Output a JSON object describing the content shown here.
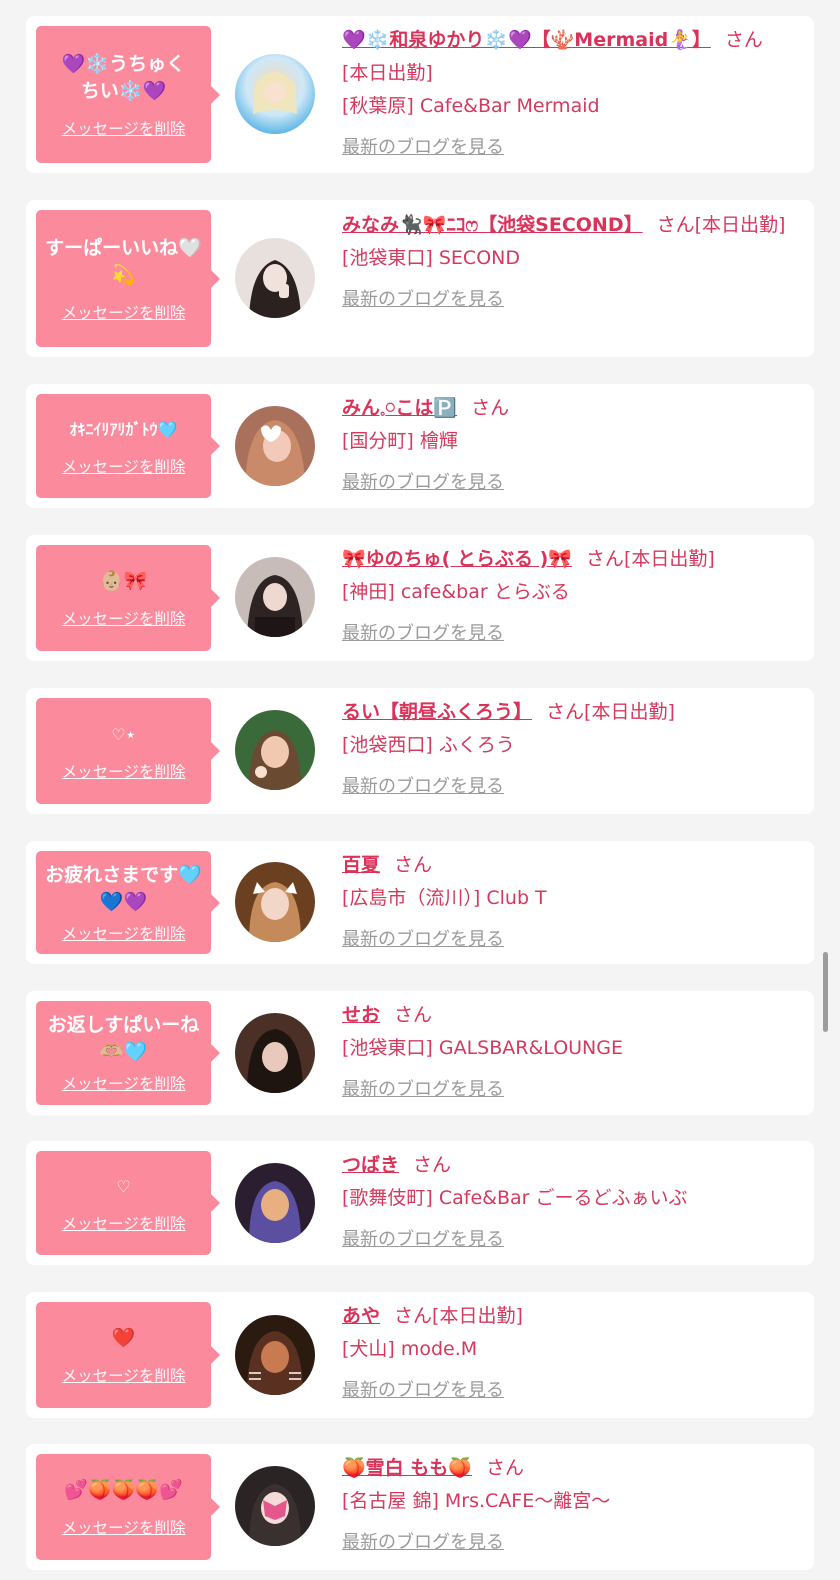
{
  "common": {
    "delete_label": "メッセージを削除",
    "san_label": "さん",
    "blog_label": "最新のブログを見る"
  },
  "colors": {
    "page_background": "#f4f4f4",
    "bubble_pink": "#fc8a9d",
    "name_pink": "#d9335a",
    "link_gray": "#9a9a9a"
  },
  "messages": [
    {
      "message": "💜❄️うちゅくちい❄️💜",
      "name": "💜❄️和泉ゆかり❄️💜【🪸Mermaid🧜‍♀️】",
      "status": "[本日出勤]",
      "shop": "[秋葉原] Cafe&Bar Mermaid",
      "avatar_colors": [
        "#cfe8f7",
        "#f3d9b8",
        "#5db6e6"
      ]
    },
    {
      "message": "すーぱーいいね🤍💫",
      "name": "みなみ🐈‍⬛🎀ﾆｺ︎ෆ【池袋SECOND】",
      "status": "[本日出勤]",
      "shop": "[池袋東口] SECOND",
      "avatar_colors": [
        "#e8e0dd",
        "#2b2220",
        "#f1e9e6"
      ]
    },
    {
      "message": "ｵｷﾆｲﾘｱﾘｶﾞﾄｳ🩵",
      "name": "みん𓈒𓏸こは🅿️",
      "status": "",
      "shop": "[国分町] 檜輝",
      "avatar_colors": [
        "#a9705c",
        "#f3c9b9",
        "#4a2b26"
      ]
    },
    {
      "message": "👶🏼🎀",
      "name": "🎀ゆのちゅ( とらぶる )🎀",
      "status": "[本日出勤]",
      "shop": "[神田] cafe&bar とらぶる",
      "avatar_colors": [
        "#c8bcb8",
        "#2e2424",
        "#e8d6cf"
      ]
    },
    {
      "message": "♡︎⋆",
      "name": "るい【朝昼ふくろう】",
      "status": "[本日出勤]",
      "shop": "[池袋西口] ふくろう",
      "avatar_colors": [
        "#3a6a3a",
        "#f0c9b0",
        "#6a4a30"
      ]
    },
    {
      "message": "お疲れさまです🩵💙💜",
      "name": "百夏",
      "status": "",
      "shop": "[広島市（流川）] Club T",
      "avatar_colors": [
        "#6a4020",
        "#f2d6c8",
        "#c48a5a"
      ]
    },
    {
      "message": "お返しすぱいーね🫶🏼🩵",
      "name": "せお",
      "status": "",
      "shop": "[池袋東口] GALSBAR&LOUNGE",
      "avatar_colors": [
        "#4a3026",
        "#e9c9bc",
        "#1e1410"
      ]
    },
    {
      "message": "♡︎",
      "name": "つばき",
      "status": "",
      "shop": "[歌舞伎町] Cafe&Bar ごーるどふぁいぶ",
      "avatar_colors": [
        "#5a4fa0",
        "#e8b080",
        "#2a1e30"
      ]
    },
    {
      "message": "❤️",
      "name": "あや",
      "status": "[本日出勤]",
      "shop": "[犬山] mode.M",
      "avatar_colors": [
        "#5a3020",
        "#c87a50",
        "#2a1a10"
      ]
    },
    {
      "message": "💕🍑🍑🍑💕",
      "name": "🍑雪白 もも🍑",
      "status": "",
      "shop": "[名古屋 錦] Mrs.CAFE〜離宮〜",
      "avatar_colors": [
        "#2a2424",
        "#f4c0c8",
        "#e04080"
      ]
    }
  ]
}
